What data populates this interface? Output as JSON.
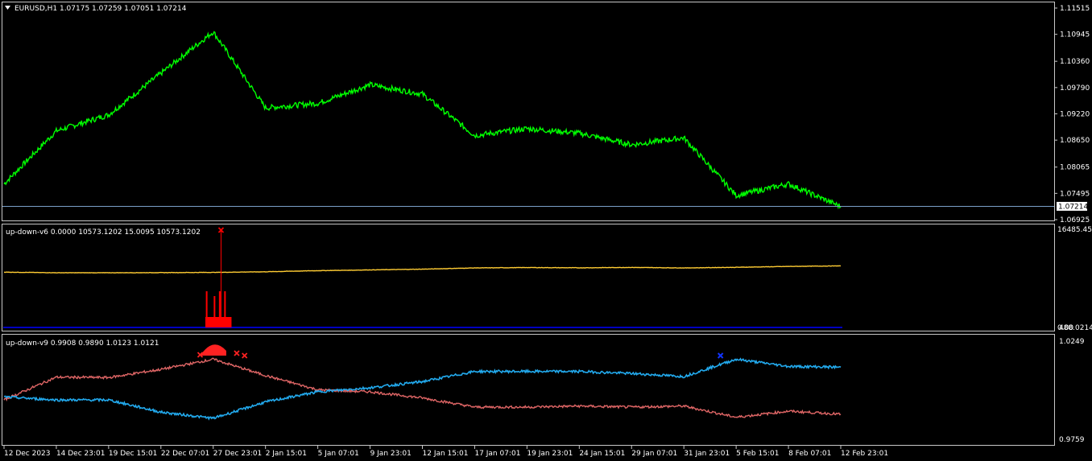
{
  "header": {
    "symbol_line": "EURUSD,H1  1.07175 1.07259 1.07051 1.07214"
  },
  "price_panel": {
    "price_ticks": [
      "1.11515",
      "1.10945",
      "1.10360",
      "1.09790",
      "1.09220",
      "1.08650",
      "1.08065",
      "1.07495",
      "1.06925"
    ],
    "current_price_label": "1.07214",
    "current_price": 1.07214,
    "colors": {
      "line": "#00ff00",
      "price_line": "#7aa0c8",
      "label_bg": "#ffffff"
    }
  },
  "panel2": {
    "title": "up-down-v6 0.0000 10573.1202 15.0095 10573.1202",
    "axis_top": "16485.450",
    "axis_bottom_a": "0.00",
    "axis_bottom_b": "488.0214",
    "colors": {
      "line": "#ffcc33",
      "bars": "#ff0000",
      "baseline": "#0000ff"
    }
  },
  "panel3": {
    "title": "up-down-v9 0.9908 0.9890 1.0123 1.0121",
    "axis_top": "1.0249",
    "axis_bottom": "0.9759",
    "colors": {
      "red_series": "#e06666",
      "blue_series": "#22aaee",
      "marker_red": "#ff2222",
      "marker_blue": "#1133ff"
    }
  },
  "time_axis": [
    "12 Dec 2023",
    "14 Dec 23:01",
    "19 Dec 15:01",
    "22 Dec 07:01",
    "27 Dec 23:01",
    "2 Jan 15:01",
    "5 Jan 07:01",
    "9 Jan 23:01",
    "12 Jan 15:01",
    "17 Jan 07:01",
    "19 Jan 23:01",
    "24 Jan 15:01",
    "29 Jan 07:01",
    "31 Jan 23:01",
    "5 Feb 15:01",
    "8 Feb 07:01",
    "12 Feb 23:01"
  ],
  "chart_data": [
    {
      "type": "line",
      "title": "EURUSD,H1",
      "x": [
        "12 Dec 2023",
        "14 Dec 23:01",
        "19 Dec 15:01",
        "22 Dec 07:01",
        "27 Dec 23:01",
        "2 Jan 15:01",
        "5 Jan 07:01",
        "9 Jan 23:01",
        "12 Jan 15:01",
        "17 Jan 07:01",
        "19 Jan 23:01",
        "24 Jan 15:01",
        "29 Jan 07:01",
        "31 Jan 23:01",
        "5 Feb 15:01",
        "8 Feb 07:01",
        "12 Feb 23:01"
      ],
      "series": [
        {
          "values": [
            1.077,
            1.0885,
            1.092,
            1.101,
            1.11,
            1.0935,
            1.0945,
            1.0985,
            1.0965,
            1.0875,
            1.089,
            1.088,
            1.0855,
            1.087,
            1.0745,
            1.077,
            1.0721
          ]
        }
      ],
      "ylim": [
        1.06925,
        1.11515
      ]
    },
    {
      "type": "line",
      "title": "up-down-v6",
      "x": [
        "12 Dec 2023",
        "14 Dec 23:01",
        "19 Dec 15:01",
        "22 Dec 07:01",
        "27 Dec 23:01",
        "2 Jan 15:01",
        "5 Jan 07:01",
        "9 Jan 23:01",
        "12 Jan 15:01",
        "17 Jan 07:01",
        "19 Jan 23:01",
        "24 Jan 15:01",
        "29 Jan 07:01",
        "31 Jan 23:01",
        "5 Feb 15:01",
        "8 Feb 07:01",
        "12 Feb 23:01"
      ],
      "series": [
        {
          "values": [
            9560,
            9460,
            9460,
            9480,
            9520,
            9620,
            9800,
            9920,
            10040,
            10240,
            10300,
            10260,
            10320,
            10240,
            10340,
            10480,
            10573
          ]
        }
      ],
      "ylim": [
        488.0214,
        16485.45
      ]
    },
    {
      "type": "line",
      "title": "up-down-v9",
      "x": [
        "12 Dec 2023",
        "14 Dec 23:01",
        "19 Dec 15:01",
        "22 Dec 07:01",
        "27 Dec 23:01",
        "2 Jan 15:01",
        "5 Jan 07:01",
        "9 Jan 23:01",
        "12 Jan 15:01",
        "17 Jan 07:01",
        "19 Jan 23:01",
        "24 Jan 15:01",
        "29 Jan 07:01",
        "31 Jan 23:01",
        "5 Feb 15:01",
        "8 Feb 07:01",
        "12 Feb 23:01"
      ],
      "series": [
        {
          "values": [
            0.996,
            1.0072,
            1.007,
            1.011,
            1.016,
            1.008,
            1.001,
            1.0,
            0.997,
            0.9925,
            0.9925,
            0.993,
            0.9925,
            0.993,
            0.9875,
            0.9905,
            0.989
          ]
        },
        {
          "values": [
            0.9975,
            0.996,
            0.996,
            0.99,
            0.987,
            0.995,
            1.0,
            1.002,
            1.005,
            1.01,
            1.01,
            1.01,
            1.009,
            1.0075,
            1.016,
            1.0125,
            1.0121
          ]
        }
      ],
      "ylim": [
        0.9759,
        1.0249
      ]
    }
  ]
}
